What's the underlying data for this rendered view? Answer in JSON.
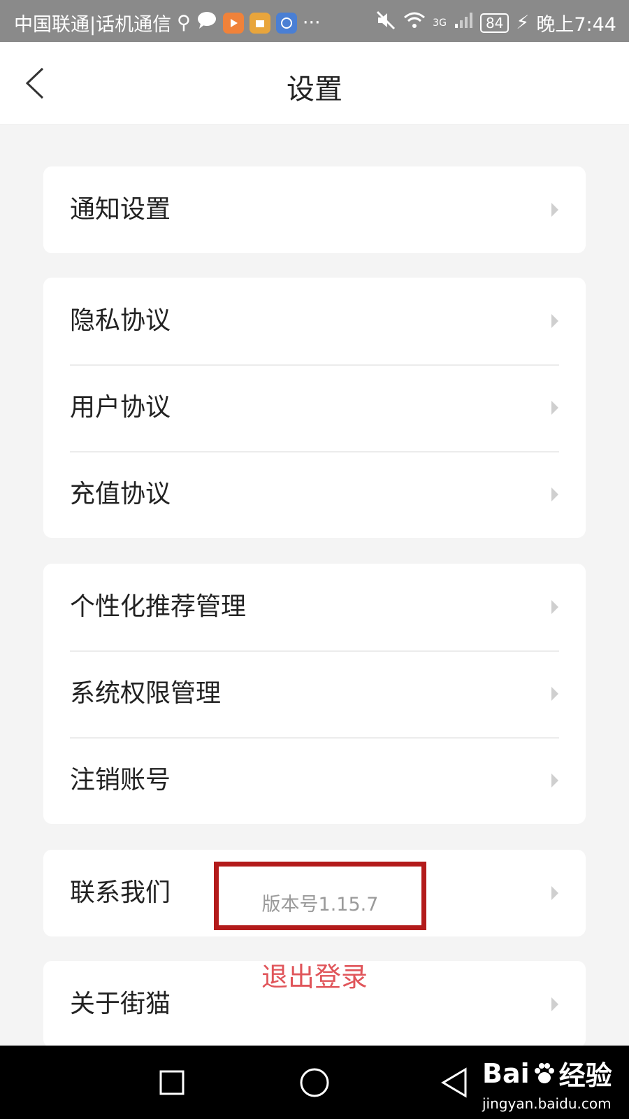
{
  "statusbar": {
    "carrier": "中国联通|话机通信",
    "network": "3G",
    "battery": "84",
    "time": "晚上7:44",
    "more": "···"
  },
  "header": {
    "title": "设置"
  },
  "groups": [
    {
      "items": [
        {
          "label": "通知设置"
        }
      ]
    },
    {
      "items": [
        {
          "label": "隐私协议"
        },
        {
          "label": "用户协议"
        },
        {
          "label": "充值协议"
        }
      ]
    },
    {
      "items": [
        {
          "label": "个性化推荐管理"
        },
        {
          "label": "系统权限管理"
        },
        {
          "label": "注销账号"
        }
      ]
    },
    {
      "items": [
        {
          "label": "联系我们"
        }
      ]
    },
    {
      "items": [
        {
          "label": "关于街猫"
        }
      ]
    }
  ],
  "version": "版本号1.15.7",
  "logout_label": "退出登录",
  "watermark": {
    "brand_left": "Bai",
    "brand_right": "经验",
    "url": "jingyan.baidu.com"
  },
  "colors": {
    "annotation_border": "#b31b1b",
    "logout_text": "#e0555a",
    "background": "#f4f4f4"
  }
}
